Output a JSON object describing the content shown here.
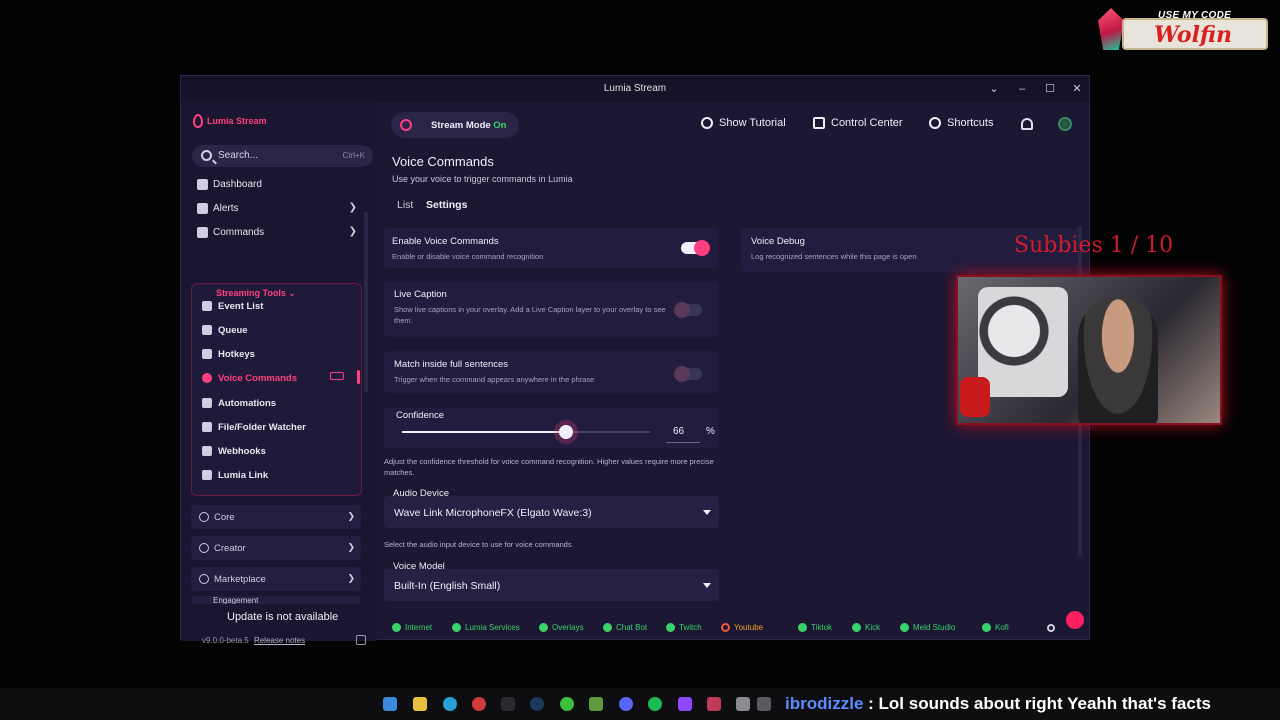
{
  "promo": {
    "line1": "USE MY CODE",
    "line2": "Wolfin"
  },
  "window": {
    "title": "Lumia Stream"
  },
  "sidebar": {
    "brand": "Lumia Stream",
    "search_placeholder": "Search...",
    "search_shortcut": "Ctrl+K",
    "items": [
      {
        "label": "Dashboard"
      },
      {
        "label": "Alerts"
      },
      {
        "label": "Commands"
      }
    ],
    "group_label": "Streaming Tools",
    "group_items": [
      {
        "label": "Event List"
      },
      {
        "label": "Queue"
      },
      {
        "label": "Hotkeys"
      },
      {
        "label": "Voice Commands"
      },
      {
        "label": "Automations"
      },
      {
        "label": "File/Folder Watcher"
      },
      {
        "label": "Webhooks"
      },
      {
        "label": "Lumia Link"
      }
    ],
    "collapsed": [
      {
        "label": "Core"
      },
      {
        "label": "Creator"
      },
      {
        "label": "Marketplace"
      },
      {
        "label": "Engagement"
      }
    ],
    "update_text": "Update is not available",
    "version": "v9.0.0-beta.5",
    "release_notes": "Release notes"
  },
  "header": {
    "stream_mode_label": "Stream Mode",
    "stream_mode_state": "On",
    "show_tutorial": "Show Tutorial",
    "control_center": "Control Center",
    "shortcuts": "Shortcuts"
  },
  "main": {
    "title": "Voice Commands",
    "subtitle": "Use your voice to trigger commands in Lumia",
    "tabs": [
      {
        "label": "List"
      },
      {
        "label": "Settings"
      }
    ],
    "settings": {
      "enable": {
        "title": "Enable Voice Commands",
        "desc": "Enable or disable voice command recognition",
        "on": true
      },
      "live_caption": {
        "title": "Live Caption",
        "desc": "Show live captions in your overlay. Add a Live Caption layer to your overlay to see them.",
        "on": false
      },
      "match_sentences": {
        "title": "Match inside full sentences",
        "desc": "Trigger when the command appears anywhere in the phrase",
        "on": false
      },
      "voice_debug": {
        "title": "Voice Debug",
        "desc": "Log recognized sentences while this page is open"
      },
      "confidence": {
        "label": "Confidence",
        "value": "66",
        "unit": "%",
        "fraction": 0.66,
        "helper": "Adjust the confidence threshold for voice command recognition. Higher values require more precise matches."
      },
      "audio_device": {
        "label": "Audio Device",
        "value": "Wave Link MicrophoneFX (Elgato Wave:3)",
        "helper": "Select the audio input device to use for voice commands"
      },
      "voice_model": {
        "label": "Voice Model",
        "value": "Built-In (English Small)"
      }
    }
  },
  "status": [
    {
      "label": "Internet",
      "state": "ok"
    },
    {
      "label": "Lumia Services",
      "state": "ok"
    },
    {
      "label": "Overlays",
      "state": "ok"
    },
    {
      "label": "Chat Bot",
      "state": "ok"
    },
    {
      "label": "Twitch",
      "state": "ok"
    },
    {
      "label": "Youtube",
      "state": "warn"
    },
    {
      "label": "Tiktok",
      "state": "ok"
    },
    {
      "label": "Kick",
      "state": "ok"
    },
    {
      "label": "Meld Studio",
      "state": "ok"
    },
    {
      "label": "Kofi",
      "state": "ok"
    }
  ],
  "overlay": {
    "subbies": "Subbies 1 / 10"
  },
  "chat": {
    "user": "ibrodizzle",
    "message": "Lol sounds about right Yeahh that's facts"
  },
  "colors": {
    "accent": "#ff3f7f",
    "ok": "#3ad16a",
    "warn": "#f59a2a",
    "bg": "#1c1733"
  }
}
